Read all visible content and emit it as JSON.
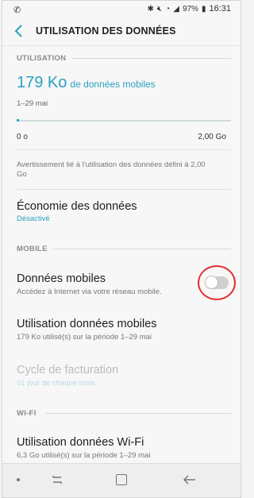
{
  "status_bar": {
    "signal_icon": "phone-icon",
    "battery": "97%",
    "time": "16:31"
  },
  "header": {
    "title": "UTILISATION DES DONNÉES"
  },
  "usage_section": {
    "label": "UTILISATION",
    "amount": "179 Ko",
    "amount_unit": "de données mobiles",
    "period": "1–29 mai",
    "progress_fraction": 0.0,
    "min_label": "0 o",
    "max_label": "2,00 Go",
    "warning": "Avertissement lié à l'utilisation des données défini à 2,00 Go"
  },
  "data_saver": {
    "title": "Économie des données",
    "subtitle": "Désactivé"
  },
  "mobile_section": {
    "label": "MOBILE",
    "mobile_data": {
      "title": "Données mobiles",
      "subtitle": "Accédez à Internet via votre réseau mobile.",
      "enabled": false
    },
    "mobile_usage": {
      "title": "Utilisation données mobiles",
      "subtitle": "179 Ko utilisé(s) sur la période 1–29 mai"
    },
    "billing_cycle": {
      "title": "Cycle de facturation",
      "subtitle": "01 jour de chaque mois"
    }
  },
  "wifi_section": {
    "label": "WI-FI",
    "wifi_usage": {
      "title": "Utilisation données Wi-Fi",
      "subtitle": "6,3 Go utilisé(s) sur la période 1–29 mai"
    }
  },
  "colors": {
    "accent": "#2aa1c0",
    "highlight": "#e23131"
  }
}
